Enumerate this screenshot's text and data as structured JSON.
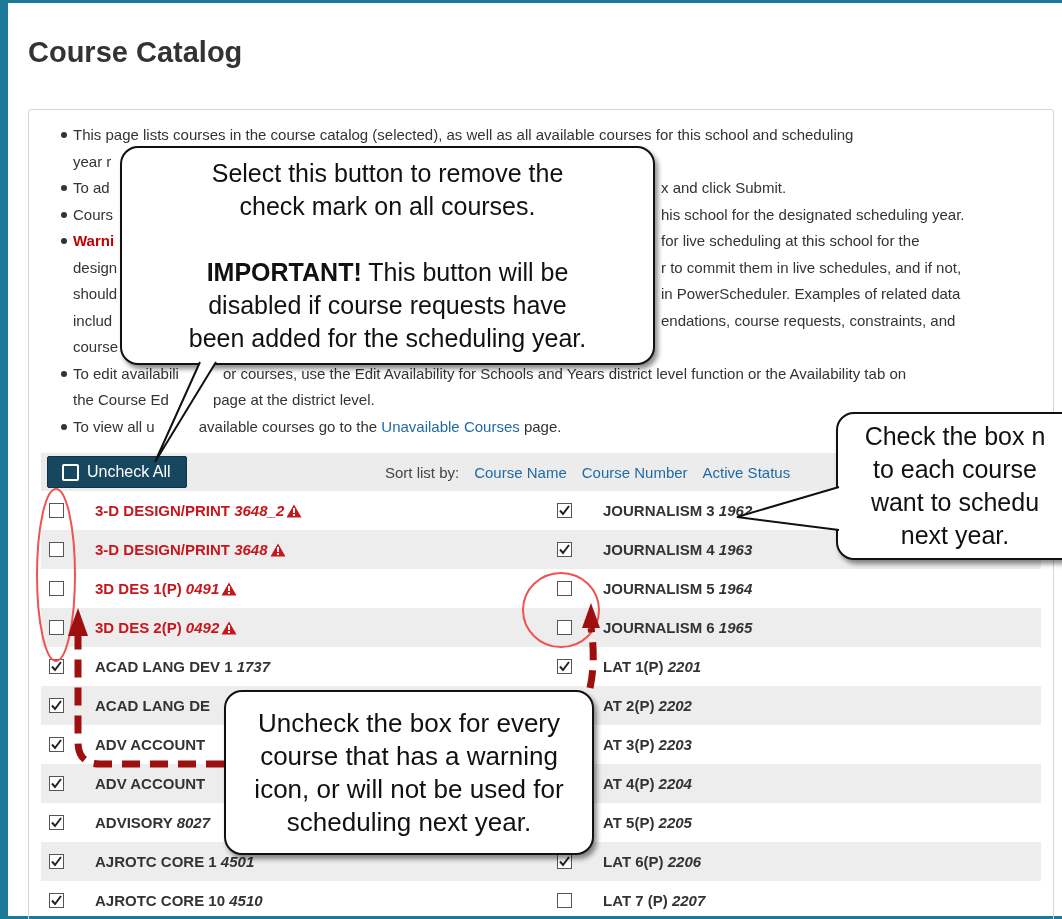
{
  "page": {
    "title": "Course Catalog"
  },
  "instructions": [
    {
      "kind": "normal",
      "lines": [
        {
          "kind": "whole",
          "left": "This page lists courses in the course catalog (selected), as well as all available courses for this school and scheduling"
        },
        {
          "kind": "covered",
          "left": "year r"
        }
      ]
    },
    {
      "kind": "normal",
      "lines": [
        {
          "kind": "covered",
          "left": "To ad",
          "right": "x and click Submit."
        }
      ]
    },
    {
      "kind": "normal",
      "lines": [
        {
          "kind": "covered",
          "left": "Cours",
          "right": "his school for the designated scheduling year."
        }
      ]
    },
    {
      "kind": "warning",
      "lines": [
        {
          "kind": "covered",
          "left": "Warni",
          "right": "for live scheduling at this school for the"
        },
        {
          "kind": "covered",
          "left": "design",
          "right": "r to commit them in live schedules, and if not,"
        },
        {
          "kind": "covered",
          "left": "should",
          "right": "in PowerScheduler. Examples of related data"
        },
        {
          "kind": "covered",
          "left": "includ",
          "right": "endations, course requests, constraints, and"
        },
        {
          "kind": "covered",
          "left": "course"
        }
      ]
    },
    {
      "kind": "normal",
      "lines": [
        {
          "kind": "crossed",
          "left": "To edit availabili",
          "right": "or courses, use the Edit Availability for Schools and Years district level function or the Availability tab on"
        },
        {
          "kind": "crossed",
          "left": "the Course Ed",
          "right": "page at the district level."
        }
      ]
    },
    {
      "kind": "normal",
      "lines": [
        {
          "kind": "crossed",
          "left": "To view all u",
          "right": "available courses go to the ",
          "link": "Unavailable Courses",
          "after": " page."
        }
      ]
    }
  ],
  "toolbar": {
    "button": "Uncheck All",
    "sort_label": "Sort list by:",
    "sort_links": [
      "Course Name",
      "Course Number",
      "Active Status"
    ]
  },
  "rows": [
    {
      "left": {
        "checked": false,
        "name": "3-D DESIGN/PRINT",
        "number": "3648_2",
        "warning": true
      },
      "right": {
        "checked": true,
        "name": "JOURNALISM 3",
        "number": "1962"
      }
    },
    {
      "left": {
        "checked": false,
        "name": "3-D DESIGN/PRINT",
        "number": "3648",
        "warning": true
      },
      "right": {
        "checked": true,
        "name": "JOURNALISM 4",
        "number": "1963"
      }
    },
    {
      "left": {
        "checked": false,
        "name": "3D DES 1(P)",
        "number": "0491",
        "warning": true
      },
      "right": {
        "checked": false,
        "name": "JOURNALISM 5",
        "number": "1964"
      }
    },
    {
      "left": {
        "checked": false,
        "name": "3D DES 2(P)",
        "number": "0492",
        "warning": true
      },
      "right": {
        "checked": false,
        "name": "JOURNALISM 6",
        "number": "1965"
      }
    },
    {
      "left": {
        "checked": true,
        "name": "ACAD LANG DEV 1",
        "number": "1737"
      },
      "right": {
        "checked": true,
        "name": "LAT 1(P)",
        "number": "2201"
      }
    },
    {
      "left": {
        "checked": true,
        "name": "ACAD LANG DE"
      },
      "right": {
        "name": "AT 2(P)",
        "number": "2202"
      }
    },
    {
      "left": {
        "checked": true,
        "name": "ADV ACCOUNT"
      },
      "right": {
        "name": "AT 3(P)",
        "number": "2203"
      }
    },
    {
      "left": {
        "checked": true,
        "name": "ADV ACCOUNT"
      },
      "right": {
        "name": "AT 4(P)",
        "number": "2204"
      }
    },
    {
      "left": {
        "checked": true,
        "name": "ADVISORY",
        "number": "8027"
      },
      "right": {
        "name": "AT 5(P)",
        "number": "2205"
      }
    },
    {
      "left": {
        "checked": true,
        "name": "AJROTC CORE 1",
        "number": "4501"
      },
      "right": {
        "checked": true,
        "name": "LAT 6(P)",
        "number": "2206"
      }
    },
    {
      "left": {
        "checked": true,
        "name": "AJROTC CORE 10",
        "number": "4510"
      },
      "right": {
        "checked": false,
        "name": "LAT 7 (P)",
        "number": "2207"
      }
    }
  ],
  "callouts": [
    {
      "kind": "top",
      "paragraphs": [
        [
          "Select this button to remove the",
          "check mark on all courses."
        ],
        [
          "**IMPORTANT!** This button will be",
          "disabled if course requests have",
          "been added for the scheduling year."
        ]
      ]
    },
    {
      "kind": "right",
      "paragraphs": [
        [
          "Check the box n",
          "to each course",
          "want to schedu",
          "next year."
        ]
      ]
    },
    {
      "kind": "bottom",
      "paragraphs": [
        [
          "Uncheck the box for every",
          "course that has a warning",
          "icon, or will not be used for",
          "scheduling next year."
        ]
      ]
    }
  ]
}
